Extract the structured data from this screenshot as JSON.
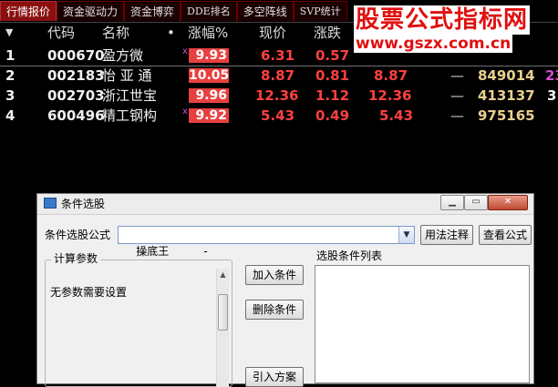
{
  "tabs": [
    {
      "label": "行情报价",
      "active": true
    },
    {
      "label": "资金驱动力",
      "active": false
    },
    {
      "label": "资金博弈",
      "active": false
    },
    {
      "label": "DDE排名",
      "active": false
    },
    {
      "label": "多空阵线",
      "active": false
    },
    {
      "label": "SVP统计",
      "active": false
    }
  ],
  "columns": {
    "code": "代码",
    "name": "名称",
    "dot": "•",
    "pct": "涨幅%",
    "price": "现价",
    "change": "涨跌"
  },
  "rows": [
    {
      "idx": "1",
      "code": "000670",
      "name": "盈方微",
      "pct": "9.93",
      "price": "6.31",
      "change": "0.57",
      "vol": "",
      "vol2": ""
    },
    {
      "idx": "2",
      "code": "002183",
      "name": "怡 亚 通",
      "pct": "10.05",
      "price": "8.87",
      "change": "0.81",
      "buy": "8.87",
      "dash": "—",
      "vol": "849014",
      "vol2": "23"
    },
    {
      "idx": "3",
      "code": "002703",
      "name": "浙江世宝",
      "pct": "9.96",
      "price": "12.36",
      "change": "1.12",
      "buy": "12.36",
      "dash": "—",
      "vol": "413137",
      "vol2": "3"
    },
    {
      "idx": "4",
      "code": "600496",
      "name": "精工钢构",
      "pct": "9.92",
      "price": "5.43",
      "change": "0.49",
      "buy": "5.43",
      "dash": "—",
      "vol": "975165",
      "vol2": ""
    }
  ],
  "watermark": {
    "title": "股票公式指标网",
    "url": "www.gszx.com.cn"
  },
  "dialog": {
    "title": "条件选股",
    "formula_label": "条件选股公式",
    "formula_value": "操底王          -",
    "usage_button": "用法注释",
    "view_button": "查看公式",
    "params_group": "计算参数",
    "params_text": "无参数需要设置",
    "add_button": "加入条件",
    "delete_button": "删除条件",
    "import_button": "引入方案",
    "list_label": "选股条件列表"
  },
  "colors": {
    "accent_red": "#e84040",
    "price_red": "#ff4040",
    "volume_yellow": "#e8d090",
    "tab_active": "#8a1010"
  }
}
